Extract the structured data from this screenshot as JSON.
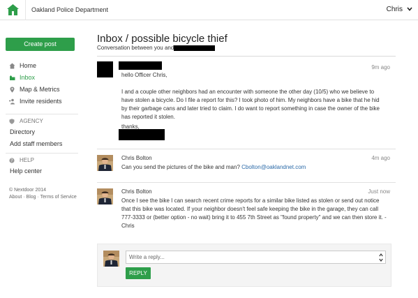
{
  "header": {
    "org_name": "Oakland Police Department",
    "user_name": "Chris",
    "logo_icon": "house-icon",
    "brand_color": "#2e9e4a"
  },
  "sidebar": {
    "create_post": "Create post",
    "nav": [
      {
        "label": "Home",
        "icon": "home-icon"
      },
      {
        "label": "Inbox",
        "icon": "inbox-icon"
      },
      {
        "label": "Map & Metrics",
        "icon": "map-pin-icon"
      },
      {
        "label": "Invite residents",
        "icon": "invite-icon"
      }
    ],
    "agency_label": "AGENCY",
    "agency_links": [
      "Directory",
      "Add staff members"
    ],
    "help_label": "HELP",
    "help_links": [
      "Help center"
    ],
    "footer": {
      "copyright": "© Nextdoor 2014",
      "links": [
        "About",
        "Blog",
        "Terms of Service"
      ]
    }
  },
  "conversation": {
    "title": "Inbox / possible bicycle thief",
    "subtitle": "Conversation between you and",
    "messages": [
      {
        "author": "",
        "time": "9m ago",
        "greeting": "hello Officer Chris,",
        "body": "I and a couple other neighbors had an encounter with someone the other day (10/5) who we believe to have stolen a bicycle. Do I file a report for this? I took photo of him. My neighbors have a bike that he hid by their garbage cans and later tried to claim. I do want to report something in case the owner of the bike has reported it stolen.",
        "signoff": "thanks,"
      },
      {
        "author": "Chris Bolton",
        "time": "4m ago",
        "body": "Can you send the pictures of the bike and man?",
        "email": "Cbolton@oaklandnet.com"
      },
      {
        "author": "Chris Bolton",
        "time": "Just now",
        "body": "Once I see the bike I can search recent crime reports for a similar bike listed as stolen or send out notice that this bike was located. If your neighbor doesn't feel safe keeping the bike in the garage, they can call 777-3333 or (better option - no wait) bring it to 455 7th Street as \"found property\" and we can then store it. - Chris"
      }
    ],
    "reply": {
      "placeholder": "Write a reply...",
      "button": "REPLY"
    }
  }
}
